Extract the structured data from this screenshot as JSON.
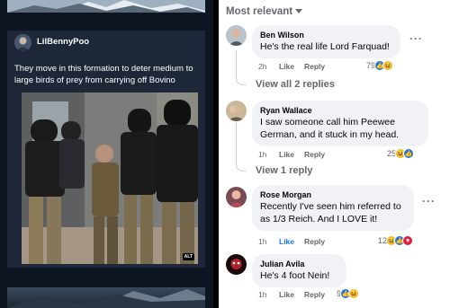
{
  "post": {
    "username": "LilBennyPoo",
    "text": "They move in this formation to deter medium to large birds of prey from carrying off Bovino",
    "alt_label": "ALT"
  },
  "comments_panel": {
    "sort_label": "Most relevant",
    "comments": [
      {
        "name": "Ben Wilson",
        "text": "He's the real life Lord Farquad!",
        "time": "2h",
        "like": "Like",
        "reply": "Reply",
        "reaction_count": "79",
        "view_replies": "View all 2 replies"
      },
      {
        "name": "Ryan Wallace",
        "text": "I saw someone call him Peewee German, and it stuck in my head.",
        "time": "1h",
        "like": "Like",
        "reply": "Reply",
        "reaction_count": "25",
        "view_replies": "View 1 reply"
      },
      {
        "name": "Rose Morgan",
        "text": "Recently I've seen him referred to as 1/3 Reich. And I LOVE it!",
        "time": "1h",
        "like": "Like",
        "reply": "Reply",
        "reaction_count": "12"
      },
      {
        "name": "Julian Avila",
        "text": "He's 4 foot Nein!",
        "time": "1h",
        "like": "Like",
        "reply": "Reply",
        "reaction_count": "9"
      }
    ],
    "more_glyph": "···"
  },
  "colors": {
    "like_active": "#1877f2",
    "bubble": "#f0f2f5",
    "muted": "#65676b",
    "post_bg": "#1e2737"
  }
}
